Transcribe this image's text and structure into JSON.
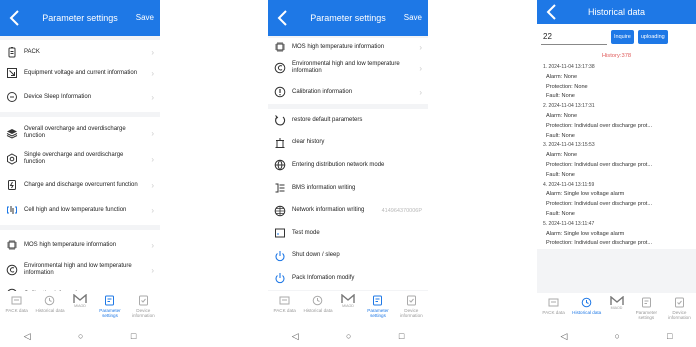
{
  "colors": {
    "accent": "#1e78e6",
    "history_count": "#e05c5c"
  },
  "screen1": {
    "title": "Parameter settings",
    "save": "Save",
    "groups": [
      [
        {
          "icon": "battery-icon",
          "label": "PACK"
        },
        {
          "icon": "voltage-current-icon",
          "label": "Equipment voltage and current information"
        },
        {
          "icon": "sleep-icon",
          "label": "Device Sleep Information"
        }
      ],
      [
        {
          "icon": "layers-icon",
          "label": "Overall overcharge and overdischarge function"
        },
        {
          "icon": "hexagon-icon",
          "label": "Single overcharge and overdischarge function"
        },
        {
          "icon": "charge-icon",
          "label": "Charge and discharge overcurrent function"
        },
        {
          "icon": "cell-temp-icon",
          "label": "Cell high and low temperature function"
        }
      ],
      [
        {
          "icon": "chip-icon",
          "label": "MOS high temperature information"
        },
        {
          "icon": "environment-icon",
          "label": "Environmental high and low temperature information"
        },
        {
          "icon": "calibration-icon",
          "label": "Calibration information"
        }
      ]
    ]
  },
  "screen2": {
    "title": "Parameter settings",
    "save": "Save",
    "top": [
      {
        "icon": "chip-icon",
        "label": "MOS high temperature information"
      },
      {
        "icon": "environment-icon",
        "label": "Environmental high and low temperature information"
      },
      {
        "icon": "calibration-icon",
        "label": "Calibration information"
      }
    ],
    "actions": [
      {
        "icon": "restore-icon",
        "label": "restore default parameters"
      },
      {
        "icon": "trash-icon",
        "label": "clear history"
      },
      {
        "icon": "globe-icon",
        "label": "Entering distribution network mode"
      },
      {
        "icon": "bms-write-icon",
        "label": "BMS information writing"
      },
      {
        "icon": "network-icon",
        "label": "Network information writing",
        "sub": "414964370006P"
      },
      {
        "icon": "test-mode-icon",
        "label": "Test mode"
      },
      {
        "icon": "power-icon",
        "label": "Shut down / sleep"
      },
      {
        "icon": "pack-modify-icon",
        "label": "Pack Infomation modify"
      }
    ]
  },
  "screen3": {
    "title": "Historical data",
    "search_value": "22",
    "inquire": "Inquire",
    "uploading": "uploading",
    "count": "History:378",
    "records": [
      {
        "head": "1. 2024-11-04 13:17:38",
        "alarm": "Alarm:  None",
        "protection": "Protection:  None",
        "fault": "Fault:  None"
      },
      {
        "head": "2. 2024-11-04 13:17:31",
        "alarm": "Alarm:  None",
        "protection": "Protection:  Individual over discharge prot...",
        "fault": "Fault:  None"
      },
      {
        "head": "3. 2024-11-04 13:15:53",
        "alarm": "Alarm:  None",
        "protection": "Protection:  Individual over discharge prot...",
        "fault": "Fault:  None"
      },
      {
        "head": "4. 2024-11-04 13:11:59",
        "alarm": "Alarm:  Single low voltage alarm",
        "protection": "Protection:  Individual over discharge prot...",
        "fault": "Fault:  None"
      },
      {
        "head": "5. 2024-11-04 13:11:47",
        "alarm": "Alarm:  Single low voltage alarm",
        "protection": "Protection:  Individual over discharge prot...",
        "fault": ""
      }
    ]
  },
  "tabs": [
    "PACK data",
    "Historical data",
    "Parameter settings",
    "Device information"
  ],
  "tab_logo": "MIAOD",
  "nav": {
    "back": "◁",
    "home": "○",
    "recent": "□"
  }
}
